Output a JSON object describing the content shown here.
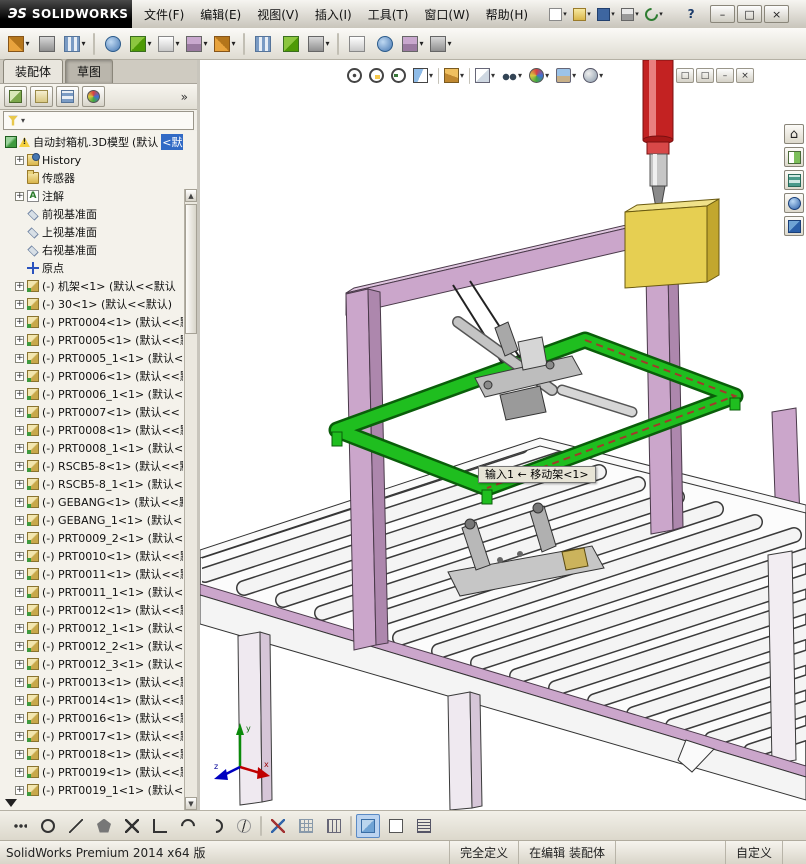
{
  "titlebar": {
    "logo_prefix": "ЭS",
    "logo_text": "SOLIDWORKS",
    "menus": [
      {
        "name": "menu-file",
        "label": "文件(F)"
      },
      {
        "name": "menu-edit",
        "label": "编辑(E)"
      },
      {
        "name": "menu-view",
        "label": "视图(V)"
      },
      {
        "name": "menu-insert",
        "label": "插入(I)"
      },
      {
        "name": "menu-tools",
        "label": "工具(T)"
      },
      {
        "name": "menu-window",
        "label": "窗口(W)"
      },
      {
        "name": "menu-help",
        "label": "帮助(H)"
      }
    ],
    "quick": [
      {
        "name": "new-doc-icon",
        "icon": "qi-new"
      },
      {
        "name": "open-doc-icon",
        "icon": "qi-open"
      },
      {
        "name": "save-icon",
        "icon": "qi-save"
      },
      {
        "name": "print-icon",
        "icon": "qi-print"
      },
      {
        "name": "undo-icon",
        "icon": "qi-undo"
      }
    ],
    "help_label": "?",
    "winbtns": [
      {
        "name": "minimize-button",
        "glyph": "–"
      },
      {
        "name": "maximize-button",
        "glyph": "□"
      },
      {
        "name": "close-button",
        "glyph": "×"
      }
    ]
  },
  "toolbar": {
    "items": [
      {
        "name": "insert-component-icon",
        "icon": "t4",
        "cls": "dd"
      },
      {
        "name": "mate-icon",
        "icon": "t6"
      },
      {
        "name": "linear-component-pattern-icon",
        "icon": "t3",
        "cls": "dd"
      },
      {
        "name": "toolbar-separator",
        "cls": "sep",
        "inter": "false"
      },
      {
        "name": "smart-fasteners-icon",
        "icon": "t5"
      },
      {
        "name": "move-component-icon",
        "icon": "t1",
        "cls": "dd"
      },
      {
        "name": "show-hidden-components-icon",
        "icon": "t2",
        "cls": "dd"
      },
      {
        "name": "assembly-features-icon",
        "icon": "t7",
        "cls": "dd"
      },
      {
        "name": "reference-geometry-icon",
        "icon": "t4",
        "cls": "dd"
      },
      {
        "name": "toolbar-separator",
        "cls": "sep",
        "inter": "false"
      },
      {
        "name": "bill-of-materials-icon",
        "icon": "t3"
      },
      {
        "name": "exploded-view-icon",
        "icon": "t1"
      },
      {
        "name": "interference-detection-icon",
        "icon": "t6",
        "cls": "dd"
      },
      {
        "name": "toolbar-separator",
        "cls": "sep",
        "inter": "false"
      },
      {
        "name": "measure-icon",
        "icon": "t2"
      },
      {
        "name": "mass-properties-icon",
        "icon": "t5"
      },
      {
        "name": "section-properties-icon",
        "icon": "t7",
        "cls": "dd"
      },
      {
        "name": "options-icon",
        "icon": "t6",
        "cls": "dd"
      }
    ]
  },
  "cmdtabs": [
    {
      "name": "tab-assembly",
      "label": "装配体",
      "cls": "active"
    },
    {
      "name": "tab-sketch",
      "label": "草图",
      "cls": "pressed"
    }
  ],
  "panelbar": {
    "tabs": [
      {
        "name": "featuremanager-tab-icon",
        "icon": "pt1"
      },
      {
        "name": "propertymanager-tab-icon",
        "icon": "pt2"
      },
      {
        "name": "configurationmanager-tab-icon",
        "icon": "pt3"
      },
      {
        "name": "appearances-tab-icon",
        "icon": "pt4"
      }
    ],
    "chevron": "»"
  },
  "tree": {
    "root": {
      "label": "自动封箱机.3D模型 ",
      "suffix": "(默认",
      "sel": "<默认"
    },
    "items": [
      {
        "exp": "plus",
        "icon": "i-hist",
        "label": "History"
      },
      {
        "exp": "none",
        "icon": "i-folder",
        "label": "传感器"
      },
      {
        "exp": "plus",
        "icon": "i-ann",
        "label": "注解"
      },
      {
        "exp": "none",
        "icon": "i-plane",
        "label": "前视基准面"
      },
      {
        "exp": "none",
        "icon": "i-plane",
        "label": "上视基准面"
      },
      {
        "exp": "none",
        "icon": "i-plane",
        "label": "右视基准面"
      },
      {
        "exp": "none",
        "icon": "i-origin",
        "label": "原点"
      },
      {
        "exp": "plus",
        "icon": "i-part",
        "label": "(-) 机架<1> (默认<<默认"
      },
      {
        "exp": "plus",
        "icon": "i-part",
        "label": "(-) 30<1> (默认<<默认)"
      },
      {
        "exp": "plus",
        "icon": "i-part",
        "label": "(-) PRT0004<1> (默认<<默"
      },
      {
        "exp": "plus",
        "icon": "i-part",
        "label": "(-) PRT0005<1> (默认<<默"
      },
      {
        "exp": "plus",
        "icon": "i-part",
        "label": "(-) PRT0005_1<1> (默认<"
      },
      {
        "exp": "plus",
        "icon": "i-part",
        "label": "(-) PRT0006<1> (默认<<默"
      },
      {
        "exp": "plus",
        "icon": "i-part",
        "label": "(-) PRT0006_1<1> (默认<"
      },
      {
        "exp": "plus",
        "icon": "i-part",
        "label": "(-) PRT0007<1> (默认<<"
      },
      {
        "exp": "plus",
        "icon": "i-part",
        "label": "(-) PRT0008<1> (默认<<默"
      },
      {
        "exp": "plus",
        "icon": "i-part",
        "label": "(-) PRT0008_1<1> (默认<"
      },
      {
        "exp": "plus",
        "icon": "i-part",
        "label": "(-) RSCB5-8<1> (默认<<默"
      },
      {
        "exp": "plus",
        "icon": "i-part",
        "label": "(-) RSCB5-8_1<1> (默认<"
      },
      {
        "exp": "plus",
        "icon": "i-part",
        "label": "(-) GEBANG<1> (默认<<默"
      },
      {
        "exp": "plus",
        "icon": "i-part",
        "label": "(-) GEBANG_1<1> (默认<"
      },
      {
        "exp": "plus",
        "icon": "i-part",
        "label": "(-) PRT0009_2<1> (默认<"
      },
      {
        "exp": "plus",
        "icon": "i-part",
        "label": "(-) PRT0010<1> (默认<<默"
      },
      {
        "exp": "plus",
        "icon": "i-part",
        "label": "(-) PRT0011<1> (默认<<默"
      },
      {
        "exp": "plus",
        "icon": "i-part",
        "label": "(-) PRT0011_1<1> (默认<"
      },
      {
        "exp": "plus",
        "icon": "i-part",
        "label": "(-) PRT0012<1> (默认<<默"
      },
      {
        "exp": "plus",
        "icon": "i-part",
        "label": "(-) PRT0012_1<1> (默认<"
      },
      {
        "exp": "plus",
        "icon": "i-part",
        "label": "(-) PRT0012_2<1> (默认<"
      },
      {
        "exp": "plus",
        "icon": "i-part",
        "label": "(-) PRT0012_3<1> (默认<"
      },
      {
        "exp": "plus",
        "icon": "i-part",
        "label": "(-) PRT0013<1> (默认<<默"
      },
      {
        "exp": "plus",
        "icon": "i-part",
        "label": "(-) PRT0014<1> (默认<<默"
      },
      {
        "exp": "plus",
        "icon": "i-part",
        "label": "(-) PRT0016<1> (默认<<默"
      },
      {
        "exp": "plus",
        "icon": "i-part",
        "label": "(-) PRT0017<1> (默认<<默"
      },
      {
        "exp": "plus",
        "icon": "i-part",
        "label": "(-) PRT0018<1> (默认<<默"
      },
      {
        "exp": "plus",
        "icon": "i-part",
        "label": "(-) PRT0019<1> (默认<<默"
      },
      {
        "exp": "plus",
        "icon": "i-part",
        "label": "(-) PRT0019_1<1> (默认<"
      }
    ]
  },
  "hud": {
    "items": [
      {
        "name": "zoom-fit-icon",
        "icon": "hu-zoomfit"
      },
      {
        "name": "zoom-area-icon",
        "icon": "hu-zoomarea"
      },
      {
        "name": "previous-view-icon",
        "icon": "hu-prev"
      },
      {
        "name": "section-view-icon",
        "icon": "hu-section",
        "cls": "dd"
      },
      {
        "name": "hud-separator",
        "cls": "hsep",
        "inter": "false"
      },
      {
        "name": "view-orientation-icon",
        "icon": "hu-orient",
        "cls": "dd"
      },
      {
        "name": "hud-separator",
        "cls": "hsep",
        "inter": "false"
      },
      {
        "name": "display-style-icon",
        "icon": "hu-style",
        "cls": "dd"
      },
      {
        "name": "hide-show-items-icon",
        "icon": "hu-hide",
        "cls": "dd"
      },
      {
        "name": "edit-appearance-icon",
        "icon": "hu-appear",
        "cls": "dd"
      },
      {
        "name": "apply-scene-icon",
        "icon": "hu-scene",
        "cls": "dd"
      },
      {
        "name": "view-settings-icon",
        "icon": "hu-set",
        "cls": "dd"
      }
    ]
  },
  "docbtns": [
    {
      "name": "doc-tile-button",
      "glyph": "□"
    },
    {
      "name": "doc-cascade-button",
      "glyph": "□"
    },
    {
      "name": "doc-minimize-button",
      "glyph": "–"
    },
    {
      "name": "doc-close-button",
      "glyph": "×"
    }
  ],
  "navrail": [
    {
      "name": "view-home-icon",
      "icon": "nv-home"
    },
    {
      "name": "show-pane-icon",
      "icon": "nv-a"
    },
    {
      "name": "view-selector-icon",
      "icon": "nv-b"
    },
    {
      "name": "orbit-view-icon",
      "icon": "nv-c"
    },
    {
      "name": "pan-view-icon",
      "icon": "nv-d"
    }
  ],
  "viewport": {
    "tooltip": "输入1 ← 移动架<1>",
    "triad": {
      "x": "x",
      "y": "y",
      "z": "z"
    }
  },
  "sketchbar": {
    "items": [
      {
        "name": "snap-settings-icon",
        "icon": "sk-dots"
      },
      {
        "name": "circle-tool-icon",
        "icon": "sk-circle"
      },
      {
        "name": "line-tool-icon",
        "icon": "sk-line"
      },
      {
        "name": "polygon-tool-icon",
        "icon": "sk-poly"
      },
      {
        "name": "point-tool-icon",
        "icon": "sk-x"
      },
      {
        "name": "angle-snap-icon",
        "icon": "sk-angle"
      },
      {
        "name": "arc-tool-icon",
        "icon": "sk-arc"
      },
      {
        "name": "tangent-arc-icon",
        "icon": "sk-arc2"
      },
      {
        "name": "spline-tool-icon",
        "icon": "sk-spline"
      },
      {
        "name": "sketchbar-separator",
        "cls": "sep",
        "inter": "false"
      },
      {
        "name": "trim-tool-icon",
        "icon": "sk-trim"
      },
      {
        "name": "grid-snap-icon",
        "icon": "sk-grid"
      },
      {
        "name": "ruler-snap-icon",
        "icon": "sk-ruler"
      },
      {
        "name": "sketchbar-separator",
        "cls": "sep",
        "inter": "false"
      },
      {
        "name": "shaded-view-icon",
        "icon": "sk-cube",
        "cls": "sel"
      },
      {
        "name": "wireframe-view-icon",
        "icon": "sk-rect"
      },
      {
        "name": "hidden-lines-view-icon",
        "icon": "sk-lines"
      }
    ]
  },
  "statusbar": {
    "product": "SolidWorks Premium 2014 x64 版",
    "state": "完全定义",
    "editing": "在编辑 装配体",
    "custom": "自定义"
  }
}
